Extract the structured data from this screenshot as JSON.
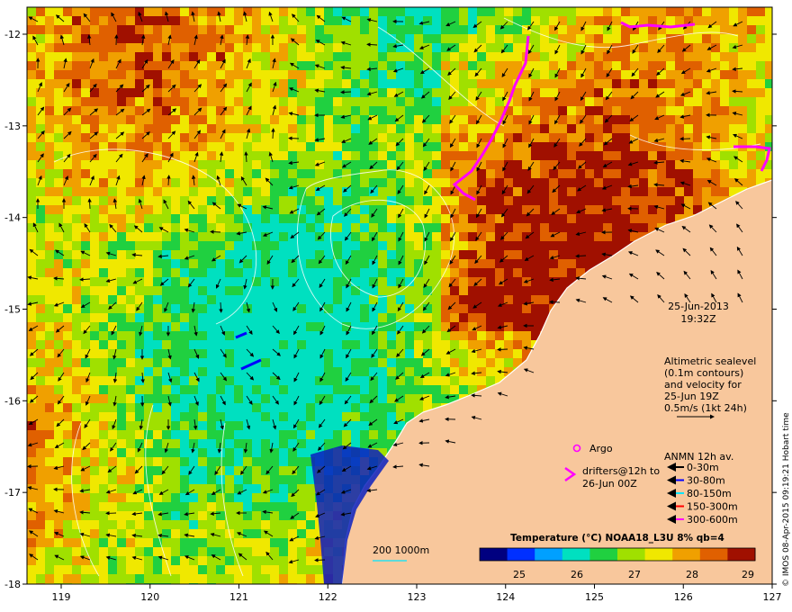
{
  "map": {
    "x_ticks": [
      "119",
      "120",
      "121",
      "122",
      "123",
      "124",
      "125",
      "126",
      "127"
    ],
    "y_ticks": [
      "-12",
      "-13",
      "-14",
      "-15",
      "-16",
      "-17",
      "-18"
    ]
  },
  "date_block": {
    "date": "25-Jun-2013",
    "time": "19:32Z"
  },
  "altimetry_note": [
    "Altimetric sealevel",
    "(0.1m contours)",
    "and velocity for",
    "25-Jun 19Z",
    "0.5m/s (1kt 24h)"
  ],
  "legend": {
    "argo": "Argo",
    "drifters": [
      "drifters@12h to",
      "26-Jun 00Z"
    ],
    "anmn_title": "ANMN 12h av.",
    "depths": [
      {
        "label": "0-30m",
        "color": "#000000"
      },
      {
        "label": "30-80m",
        "color": "#0000ff"
      },
      {
        "label": "80-150m",
        "color": "#00e5ff"
      },
      {
        "label": "150-300m",
        "color": "#ff0000"
      },
      {
        "label": "300-600m",
        "color": "#ff00ff"
      }
    ],
    "argo_color": "#ff00ff",
    "drifter_color": "#ff00ff"
  },
  "bathymetry_label": "200  1000m",
  "colorbar": {
    "title": "Temperature (°C) NOAA18_L3U 8% qb=4",
    "ticks": [
      "25",
      "26",
      "27",
      "28",
      "29"
    ],
    "colors": [
      "#000080",
      "#0030ff",
      "#00a0ff",
      "#00e0c0",
      "#20d040",
      "#a0e000",
      "#f0e800",
      "#f0a000",
      "#e06000",
      "#a01000"
    ]
  },
  "credit": "© IMOS 08-Apr-2015 09:19:21 Hobart time",
  "colors": {
    "land": "#f8c79c",
    "coast": "#ffffff"
  }
}
